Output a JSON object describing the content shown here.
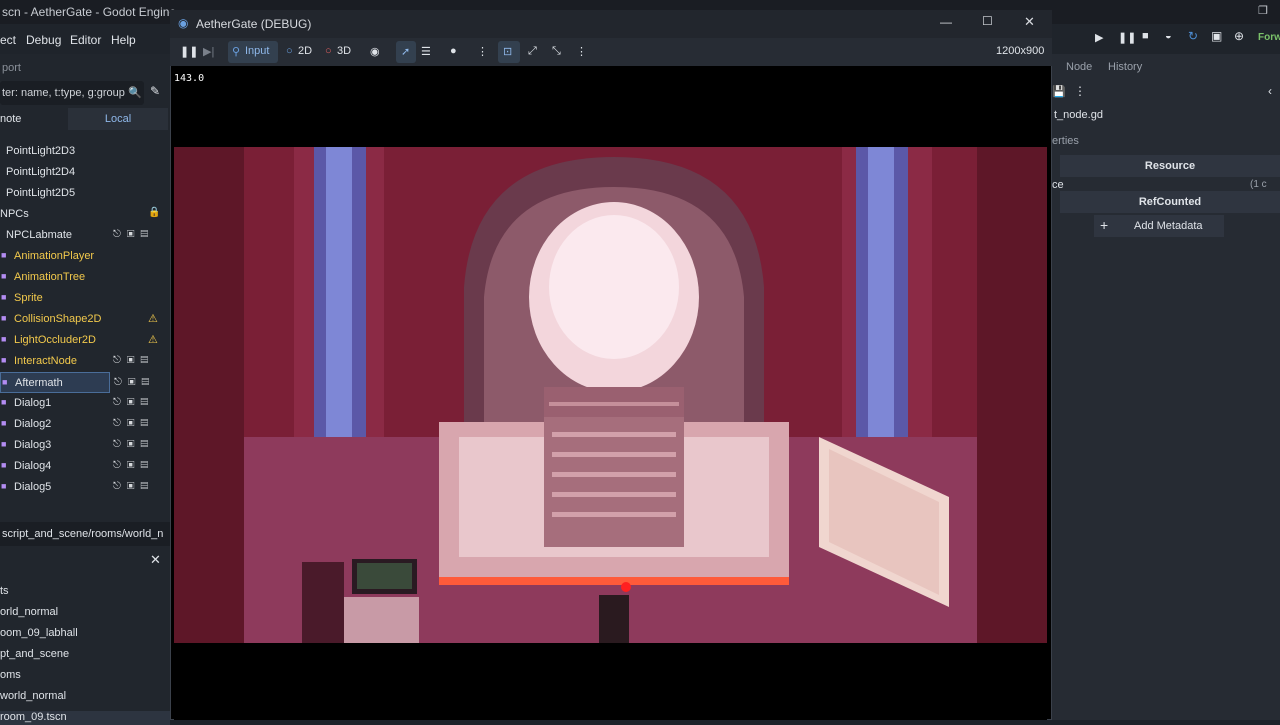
{
  "editor": {
    "title": "scn - AetherGate - Godot Engine",
    "menu": [
      "ect",
      "Debug",
      "Editor",
      "Help"
    ],
    "dock_title": "port",
    "filter_placeholder": "ter: name, t:type, g:group",
    "tabs": [
      "note",
      "Local"
    ],
    "tree": [
      {
        "label": "PointLight2D3",
        "indent": 6,
        "color": "#dfe3e8",
        "icon": ""
      },
      {
        "label": "PointLight2D4",
        "indent": 6,
        "color": "#dfe3e8",
        "icon": ""
      },
      {
        "label": "PointLight2D5",
        "indent": 6,
        "color": "#dfe3e8",
        "icon": ""
      },
      {
        "label": "NPCs",
        "indent": 0,
        "color": "#dfe3e8",
        "icon": "lock"
      },
      {
        "label": "NPCLabmate",
        "indent": 6,
        "color": "#dfe3e8",
        "icon": "row"
      },
      {
        "label": "AnimationPlayer",
        "indent": 14,
        "color": "#f2c94c",
        "icon": ""
      },
      {
        "label": "AnimationTree",
        "indent": 14,
        "color": "#f2c94c",
        "icon": ""
      },
      {
        "label": "Sprite",
        "indent": 14,
        "color": "#f2c94c",
        "icon": ""
      },
      {
        "label": "CollisionShape2D",
        "indent": 14,
        "color": "#f2c94c",
        "icon": "warn"
      },
      {
        "label": "LightOccluder2D",
        "indent": 14,
        "color": "#f2c94c",
        "icon": "warn"
      },
      {
        "label": "InteractNode",
        "indent": 14,
        "color": "#f2c94c",
        "icon": "row"
      },
      {
        "label": "Aftermath",
        "indent": 14,
        "color": "#dfe3e8",
        "icon": "row",
        "selected": true
      },
      {
        "label": "Dialog1",
        "indent": 14,
        "color": "#dfe3e8",
        "icon": "row"
      },
      {
        "label": "Dialog2",
        "indent": 14,
        "color": "#dfe3e8",
        "icon": "row"
      },
      {
        "label": "Dialog3",
        "indent": 14,
        "color": "#dfe3e8",
        "icon": "row"
      },
      {
        "label": "Dialog4",
        "indent": 14,
        "color": "#dfe3e8",
        "icon": "row"
      },
      {
        "label": "Dialog5",
        "indent": 14,
        "color": "#dfe3e8",
        "icon": "row"
      }
    ],
    "path": "script_and_scene/rooms/world_n",
    "filesystem": [
      "ts",
      "orld_normal",
      "oom_09_labhall",
      "pt_and_scene",
      "oms",
      "world_normal",
      "room_09.tscn"
    ],
    "right_tabs": [
      "Node",
      "History"
    ],
    "script_file": "t_node.gd",
    "properties_label": "erties",
    "resource_label": "Resource",
    "ce_label": "ce",
    "ce_value": "(1 c",
    "refcounted_label": "RefCounted",
    "add_metadata": "Add Metadata",
    "run_label": "Forw"
  },
  "game": {
    "title": "AetherGate (DEBUG)",
    "toolbar": {
      "input": "Input",
      "mode2d": "2D",
      "mode3d": "3D",
      "resolution": "1200x900"
    },
    "fps": "143.0"
  },
  "colors": {
    "accent": "#4d8fd6",
    "warning": "#f2c94c",
    "scene_bg": "#8a2440"
  }
}
